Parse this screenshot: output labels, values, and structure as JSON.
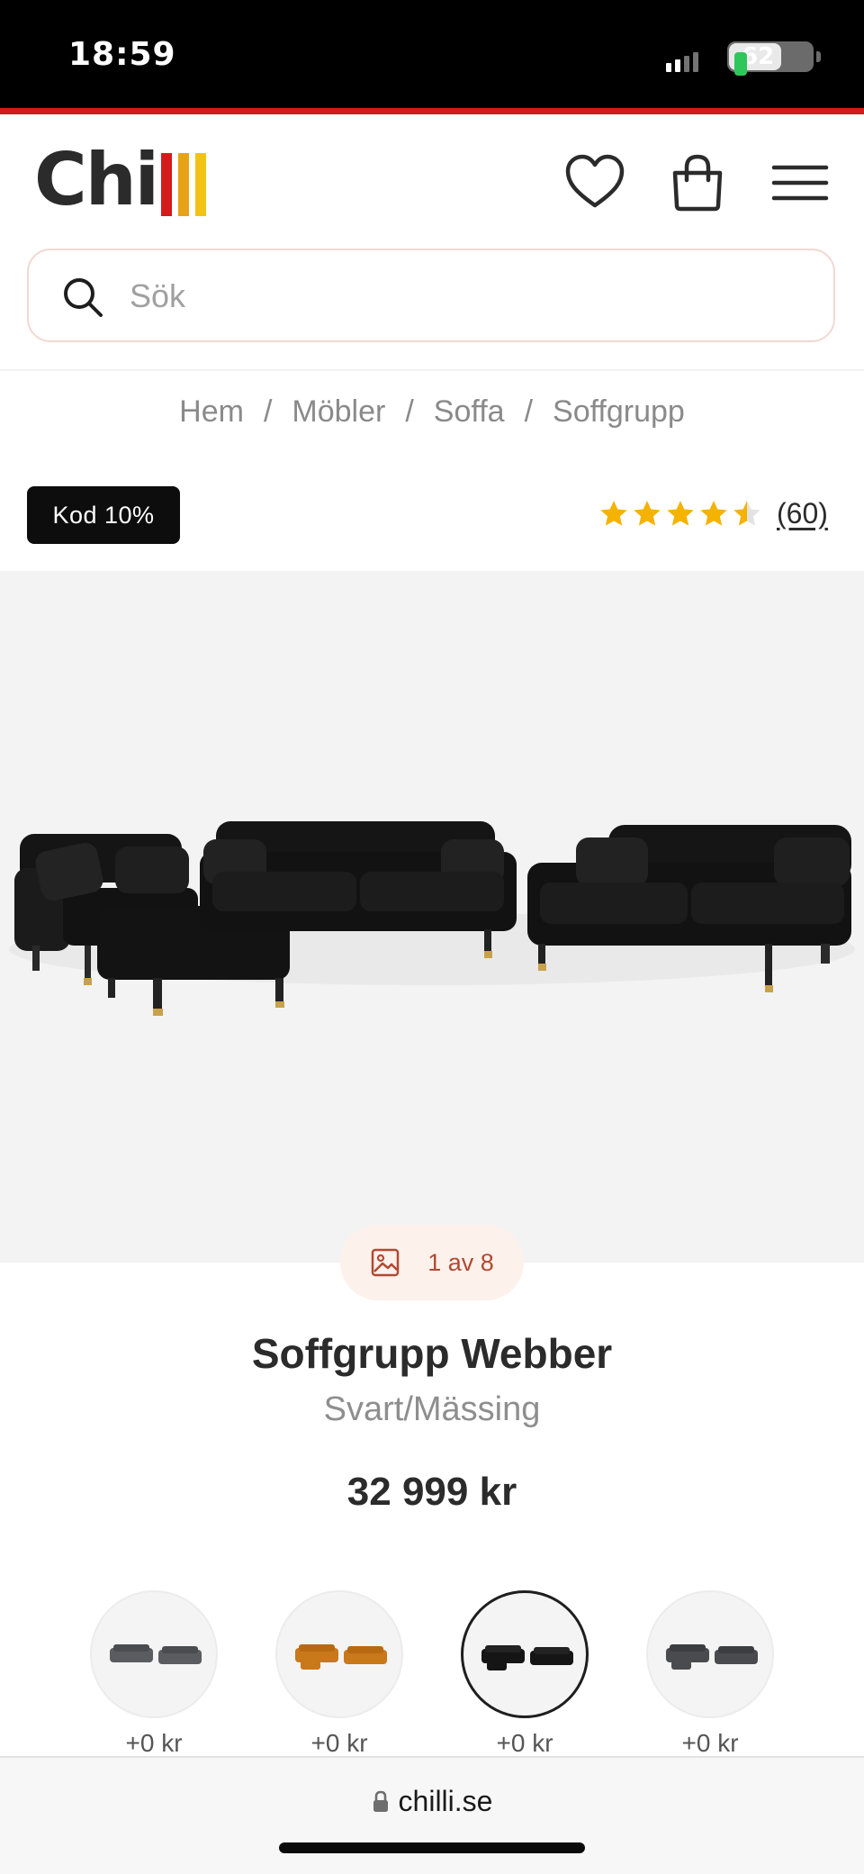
{
  "status_bar": {
    "time": "18:59",
    "battery": "62"
  },
  "header": {
    "logo_text": "Chi",
    "logo_bar_colors": [
      "#d31b1b",
      "#e6a317",
      "#f2c315"
    ],
    "icons": [
      "heart-icon",
      "shopping-bag-icon",
      "hamburger-menu-icon"
    ]
  },
  "search": {
    "placeholder": "Sök",
    "value": ""
  },
  "breadcrumb": [
    "Hem",
    "Möbler",
    "Soffa",
    "Soffgrupp"
  ],
  "badge": "Kod 10%",
  "rating": {
    "stars": 4.5,
    "count": "(60)",
    "star_color": "#f5b301"
  },
  "gallery": {
    "counter": "1 av 8"
  },
  "product": {
    "title": "Soffgrupp Webber",
    "variant": "Svart/Mässing",
    "price": "32 999 kr"
  },
  "swatches": [
    {
      "price": "+0 kr",
      "color": "#5a5c60",
      "active": false
    },
    {
      "price": "+0 kr",
      "color": "#c9781a",
      "active": false
    },
    {
      "price": "+0 kr",
      "color": "#151515",
      "active": true
    },
    {
      "price": "+0 kr",
      "color": "#4a4b4f",
      "active": false
    }
  ],
  "browser": {
    "url": "chilli.se"
  },
  "colors": {
    "brand_red": "#d31b1b",
    "accent_text": "#b04a32"
  }
}
